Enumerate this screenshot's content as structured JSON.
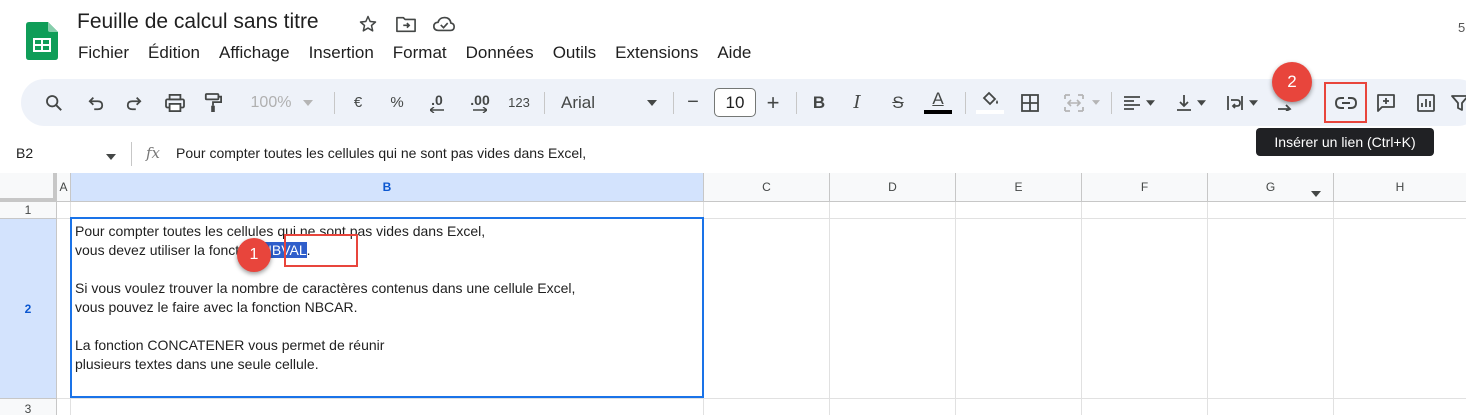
{
  "header": {
    "title": "Feuille de calcul sans titre",
    "right_edge_digit": "5"
  },
  "menu": [
    "Fichier",
    "Édition",
    "Affichage",
    "Insertion",
    "Format",
    "Données",
    "Outils",
    "Extensions",
    "Aide"
  ],
  "toolbar": {
    "zoom": "100%",
    "currency": "€",
    "percent": "%",
    "dec_decrease": ".0",
    "dec_increase": ".00",
    "number_format": "123",
    "font": "Arial",
    "font_size": "10",
    "minus": "−",
    "plus": "+",
    "bold": "B",
    "italic": "I",
    "strike": "S",
    "text_color_letter": "A"
  },
  "tooltip": "Insérer un lien (Ctrl+K)",
  "formula_bar": {
    "name_box": "B2",
    "fx": "fx",
    "content": "Pour compter toutes les cellules qui ne sont pas vides dans Excel,"
  },
  "grid": {
    "columns": [
      "A",
      "B",
      "C",
      "D",
      "E",
      "F",
      "G",
      "H"
    ],
    "rows": [
      "1",
      "2",
      "3"
    ],
    "cell_b2": {
      "line1": "Pour compter toutes les cellules qui ne sont pas vides dans Excel,",
      "line2_before": "vous devez utiliser la fonction ",
      "line2_highlight": "NBVAL",
      "line2_after": ".",
      "line3": "",
      "line4": "Si vous voulez trouver la nombre de caractères contenus dans une cellule Excel,",
      "line5": "vous pouvez le faire avec la fonction NBCAR.",
      "line6": "",
      "line7": "La fonction CONCATENER vous permet de réunir",
      "line8": "plusieurs textes dans une seule cellule."
    }
  },
  "annotations": {
    "badge1": "1",
    "badge2": "2",
    "color": "#e8453c"
  },
  "colors": {
    "selection_blue": "#1a73e8",
    "toolbar_bg": "#eef2f9",
    "header_selected_bg": "#d3e3fd",
    "highlight_bg": "#2f5ecb"
  }
}
